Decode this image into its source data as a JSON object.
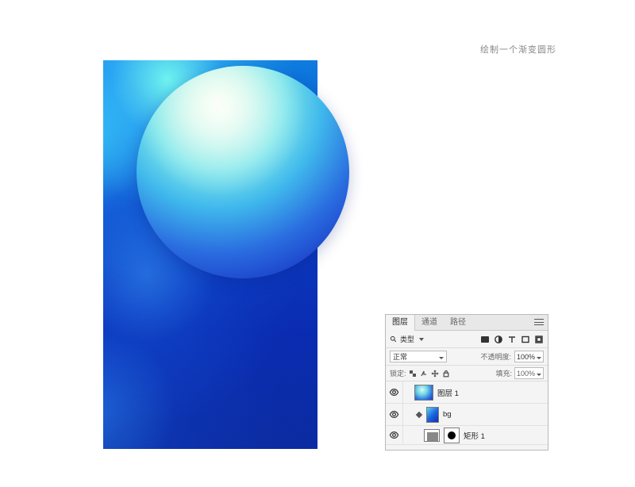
{
  "instruction": "绘制一个渐变圆形",
  "panel": {
    "tabs": {
      "layers": "图层",
      "channels": "通道",
      "paths": "路径"
    },
    "kind_label": "类型",
    "blend_mode": "正常",
    "opacity_label": "不透明度:",
    "opacity_value": "100%",
    "lock_label": "锁定:",
    "fill_label": "填充:",
    "fill_value": "100%",
    "layers": [
      {
        "name": "图层 1"
      },
      {
        "name": "bg"
      },
      {
        "name": "矩形 1"
      }
    ]
  }
}
